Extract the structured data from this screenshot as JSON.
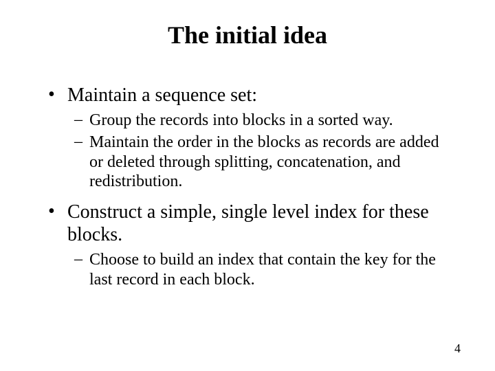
{
  "title": "The initial idea",
  "bullets": [
    {
      "text": "Maintain a sequence set:",
      "sub": [
        "Group the records into blocks in a sorted way.",
        "Maintain the order in the blocks as records are added or deleted through splitting, concatenation, and redistribution."
      ]
    },
    {
      "text": "Construct a simple, single level index for these blocks.",
      "sub": [
        "Choose to build an index that contain the key for the last record in each block."
      ]
    }
  ],
  "page_number": "4",
  "glyphs": {
    "dot": "•",
    "dash": "–"
  }
}
